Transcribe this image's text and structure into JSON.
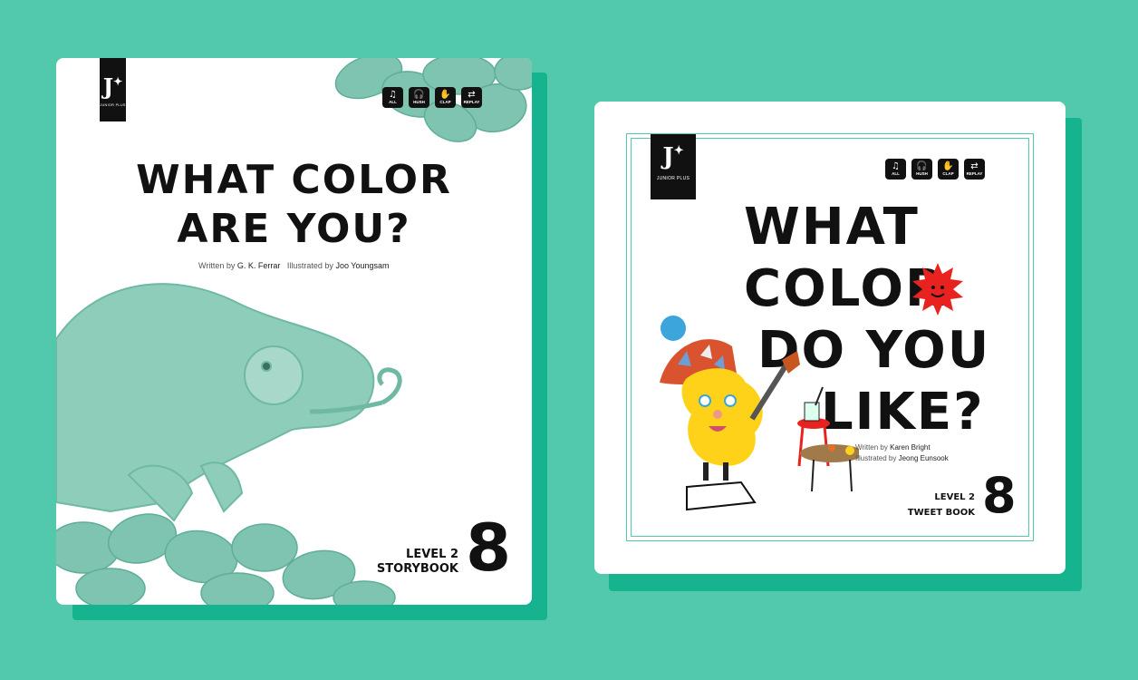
{
  "books": [
    {
      "brand": {
        "mark": "J",
        "star": "✦",
        "sub": "JUNIOR PLUS"
      },
      "controls": [
        {
          "icon": "♫",
          "label": "ALL"
        },
        {
          "icon": "🎧",
          "label": "HUSH"
        },
        {
          "icon": "✋",
          "label": "CLAP"
        },
        {
          "icon": "⇄",
          "label": "REPLAY"
        }
      ],
      "title_line1": "WHAT COLOR",
      "title_line2": "ARE YOU?",
      "written_prefix": "Written by",
      "author": "G. K. Ferrar",
      "illustrated_prefix": "Illustrated by",
      "illustrator": "Joo Youngsam",
      "level": "LEVEL 2",
      "series": "STORYBOOK",
      "number": "8",
      "accent": "#7ec4b0"
    },
    {
      "brand": {
        "mark": "J",
        "star": "✦",
        "sub": "JUNIOR PLUS"
      },
      "controls": [
        {
          "icon": "♫",
          "label": "ALL"
        },
        {
          "icon": "🎧",
          "label": "HUSH"
        },
        {
          "icon": "✋",
          "label": "CLAP"
        },
        {
          "icon": "⇄",
          "label": "REPLAY"
        }
      ],
      "title_line1": "WHAT",
      "title_line2": "COLOR",
      "title_line3": "DO YOU",
      "title_line4": "LIKE?",
      "written_prefix": "Written by",
      "author": "Karen Bright",
      "illustrated_prefix": "Illustrated by",
      "illustrator": "Jeong Eunsook",
      "level": "LEVEL 2",
      "series": "TWEET BOOK",
      "number": "8",
      "accent": "#52c8ad"
    }
  ],
  "colors": {
    "background": "#52c8ad",
    "shadow": "#16b48e",
    "chameleon": "#7ec4b0",
    "sun_red": "#e8231f",
    "character_yellow": "#ffd21a",
    "hat_red": "#d9532e"
  }
}
